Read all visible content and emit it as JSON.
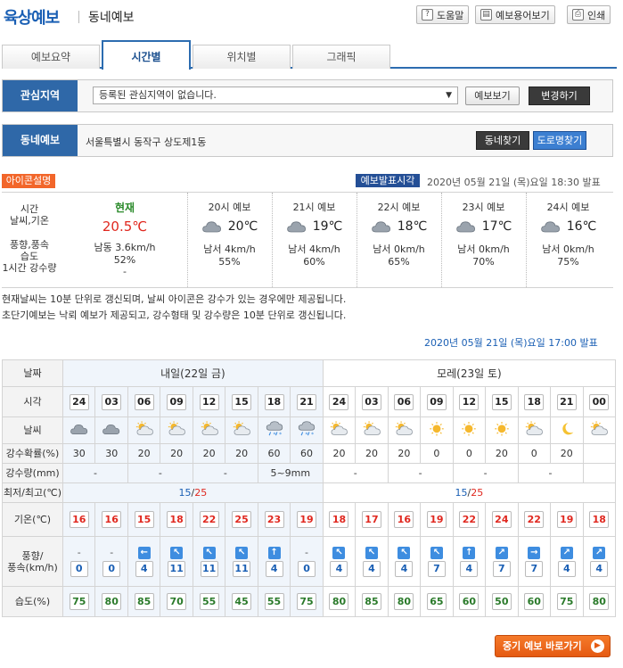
{
  "header": {
    "title": "육상예보",
    "subtitle": "동네예보",
    "buttons": [
      {
        "label": "도움말",
        "icon": "question-icon"
      },
      {
        "label": "예보용어보기",
        "icon": "book-icon"
      },
      {
        "label": "인쇄",
        "icon": "printer-icon"
      }
    ]
  },
  "tabs": [
    {
      "label": "예보요약",
      "active": false
    },
    {
      "label": "시간별",
      "active": true
    },
    {
      "label": "위치별",
      "active": false
    },
    {
      "label": "그래픽",
      "active": false
    }
  ],
  "region": {
    "label": "관심지역",
    "select_value": "등록된 관심지역이 없습니다.",
    "view_btn": "예보보기",
    "change_btn": "변경하기"
  },
  "town": {
    "label": "동네예보",
    "address": "서울특별시 동작구 상도제1동",
    "find_btn": "동네찾기",
    "road_btn": "도로명찾기"
  },
  "icon_desc": "아이콘설명",
  "issue": {
    "tag": "예보발표시각",
    "time": "2020년 05월 21일 (목)요일 18:30 발표"
  },
  "now_labels": [
    "시간",
    "날씨,기온",
    "풍향,풍속",
    "습도",
    "1시간 강수량"
  ],
  "now": {
    "label": "현재",
    "temp": "20.5℃",
    "wind": "남동 3.6km/h",
    "humid": "52%",
    "rain": "-"
  },
  "hourly": [
    {
      "label": "20시 예보",
      "temp": "20℃",
      "wind": "남서 4km/h",
      "humid": "55%"
    },
    {
      "label": "21시 예보",
      "temp": "19℃",
      "wind": "남서 4km/h",
      "humid": "60%"
    },
    {
      "label": "22시 예보",
      "temp": "18℃",
      "wind": "남서 0km/h",
      "humid": "65%"
    },
    {
      "label": "23시 예보",
      "temp": "17℃",
      "wind": "남서 0km/h",
      "humid": "70%"
    },
    {
      "label": "24시 예보",
      "temp": "16℃",
      "wind": "남서 0km/h",
      "humid": "75%"
    }
  ],
  "notes": [
    "현재날씨는 10분 단위로 갱신되며, 날씨 아이콘은 강수가 있는 경우에만 제공됩니다.",
    "초단기예보는 낙뢰 예보가 제공되고, 강수형태 및 강수량은 10분 단위로 갱신됩니다."
  ],
  "issue2": "2020년 05월 21일 (목)요일 17:00 발표",
  "grid": {
    "labels": {
      "day": "날짜",
      "time": "시각",
      "weather": "날씨",
      "pop": "강수확률(%)",
      "rain": "강수량(mm)",
      "minmax": "최저/최고(℃)",
      "temp": "기온(℃)",
      "wind1": "풍향/",
      "wind2": "풍속(km/h)",
      "humid": "습도(%)"
    },
    "days": [
      "내일(22일 금)",
      "모레(23일 토)"
    ],
    "minmax": [
      {
        "min": "15",
        "max": "25"
      },
      {
        "min": "15",
        "max": "25"
      }
    ],
    "times": [
      "24",
      "03",
      "06",
      "09",
      "12",
      "15",
      "18",
      "21",
      "24",
      "03",
      "06",
      "09",
      "12",
      "15",
      "18",
      "21",
      "00"
    ],
    "weather": [
      "cloudy-icon",
      "cloudy-icon",
      "partly-cloudy-icon",
      "partly-cloudy-icon",
      "partly-cloudy-icon",
      "partly-cloudy-icon",
      "snow-rain-icon",
      "snow-rain-icon",
      "partly-cloudy-icon",
      "partly-cloudy-icon",
      "partly-cloudy-icon",
      "sunny-icon",
      "sunny-icon",
      "sunny-icon",
      "partly-cloudy-icon",
      "moon-icon",
      "partly-cloudy-icon"
    ],
    "pop": [
      "30",
      "30",
      "20",
      "20",
      "20",
      "20",
      "60",
      "60",
      "20",
      "20",
      "20",
      "0",
      "0",
      "20",
      "0",
      "20"
    ],
    "rain": [
      "-",
      "-",
      "-",
      "5~9mm",
      "-",
      "-",
      "-",
      "-"
    ],
    "temp": [
      "16",
      "16",
      "15",
      "18",
      "22",
      "25",
      "23",
      "19",
      "18",
      "17",
      "16",
      "19",
      "22",
      "24",
      "22",
      "19",
      "18"
    ],
    "wind_dir": [
      "-",
      "-",
      "←",
      "↖",
      "↖",
      "↖",
      "↑",
      "-",
      "↖",
      "↖",
      "↖",
      "↖",
      "↑",
      "↗",
      "→",
      "↗",
      "↗"
    ],
    "wind_speed": [
      "0",
      "0",
      "4",
      "11",
      "11",
      "11",
      "4",
      "0",
      "4",
      "4",
      "4",
      "7",
      "4",
      "7",
      "7",
      "4",
      "4"
    ],
    "humid": [
      "75",
      "80",
      "85",
      "70",
      "55",
      "45",
      "55",
      "75",
      "80",
      "85",
      "80",
      "65",
      "60",
      "50",
      "60",
      "75",
      "80"
    ]
  },
  "mid_btn": "중기 예보 바로가기"
}
